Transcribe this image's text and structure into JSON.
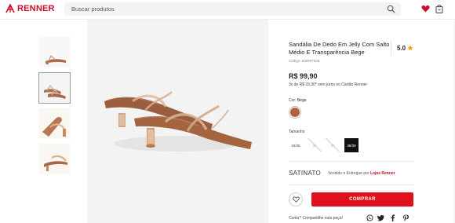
{
  "header": {
    "brand": "RENNER",
    "search_placeholder": "Buscar produtos",
    "icons": [
      "renner-logo-icon",
      "search-icon",
      "heart-icon",
      "bag-icon"
    ],
    "brand_color": "#c8102e"
  },
  "gallery": {
    "thumbnails": [
      {
        "label": "thumbnail-1",
        "active": false
      },
      {
        "label": "thumbnail-2",
        "active": true
      },
      {
        "label": "thumbnail-3",
        "active": false
      },
      {
        "label": "thumbnail-4",
        "active": false
      }
    ]
  },
  "product": {
    "title": "Sandália De Dedo Em Jelly Com Salto Médio E Transparência Bege",
    "code": "Código: 930697026",
    "rating": "5.0",
    "price": "R$ 99,90",
    "installments": "3x de R$ 33,30* sem juros no Cartão Renner",
    "color_label": "Cor:",
    "color_value": "Bege",
    "swatch_color": "#b2613d",
    "size_label": "Tamanho",
    "sizes": [
      {
        "label": "34/35",
        "state": "available"
      },
      {
        "label": "36",
        "state": "disabled"
      },
      {
        "label": "37",
        "state": "disabled"
      },
      {
        "label": "38/39",
        "state": "selected"
      }
    ],
    "seller_brand": "SATINATO",
    "sold_by_prefix": "Vendido e Entregue por",
    "sold_by_name": "Lojas Renner",
    "buy_label": "COMPRAR",
    "share_label": "Curtiu? Compartilhe esta peça!",
    "share_icons": [
      "whatsapp-icon",
      "twitter-icon",
      "facebook-icon",
      "pinterest-icon"
    ],
    "buy_color": "#e0101f"
  }
}
